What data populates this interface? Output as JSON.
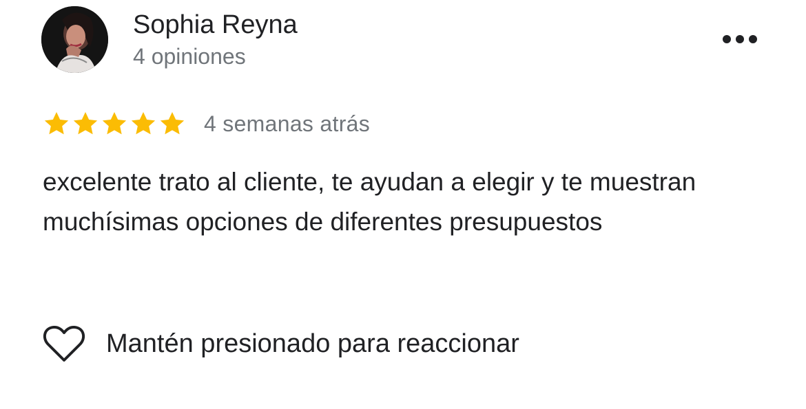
{
  "reviewer": {
    "name": "Sophia Reyna",
    "reviews_count": "4 opiniones",
    "avatar_icon": "profile-photo"
  },
  "more_icon": "more-horizontal-icon",
  "review": {
    "rating": 5,
    "max_rating": 5,
    "star_color": "#fbbc04",
    "time_ago": "4 semanas atrás",
    "text": "excelente trato al cliente, te ayudan a elegir y te muestran muchísimas opciones de diferentes presupuestos"
  },
  "reaction": {
    "icon": "heart-outline-icon",
    "label": "Mantén presionado para reaccionar"
  }
}
